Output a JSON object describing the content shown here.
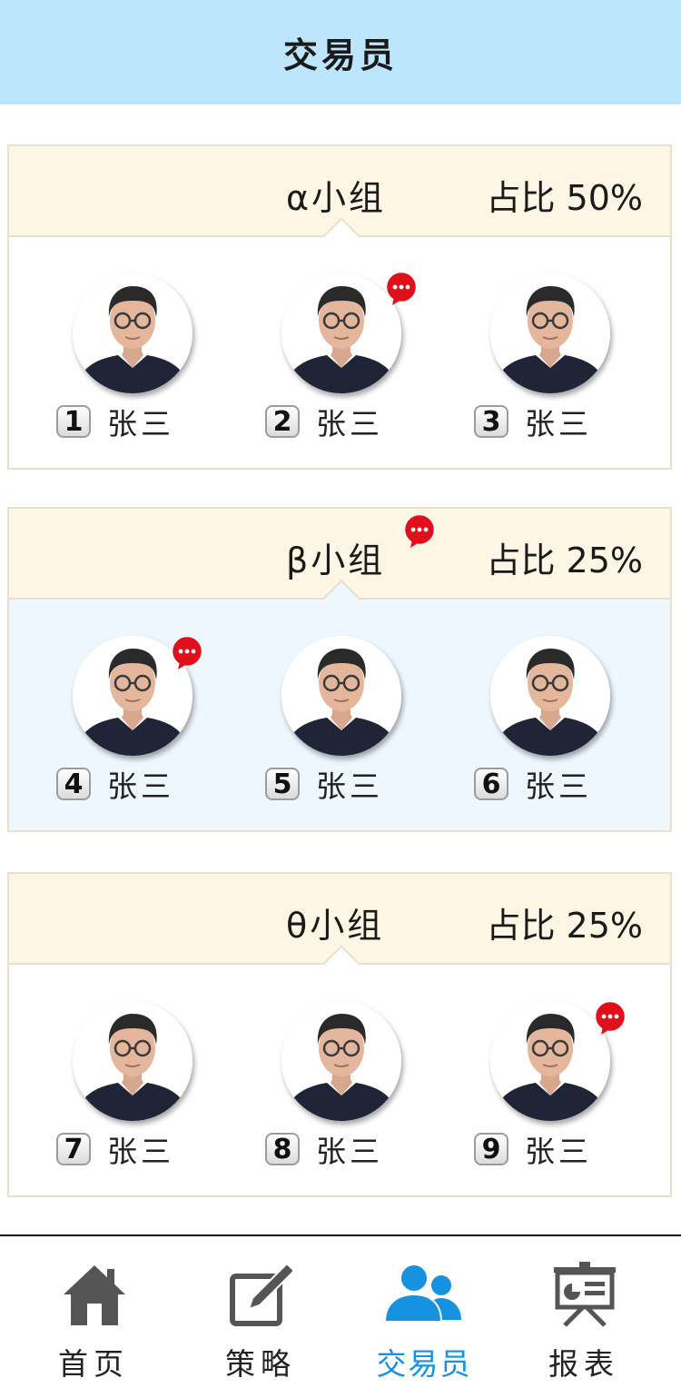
{
  "header": {
    "title": "交易员"
  },
  "groups": [
    {
      "name": "α小组",
      "share_label": "占比",
      "share_value": "50%",
      "members": [
        {
          "rank": "1",
          "name": "张三"
        },
        {
          "rank": "2",
          "name": "张三"
        },
        {
          "rank": "3",
          "name": "张三"
        }
      ]
    },
    {
      "name": "β小组",
      "share_label": "占比",
      "share_value": "25%",
      "members": [
        {
          "rank": "4",
          "name": "张三"
        },
        {
          "rank": "5",
          "name": "张三"
        },
        {
          "rank": "6",
          "name": "张三"
        }
      ]
    },
    {
      "name": "θ小组",
      "share_label": "占比",
      "share_value": "25%",
      "members": [
        {
          "rank": "7",
          "name": "张三"
        },
        {
          "rank": "8",
          "name": "张三"
        },
        {
          "rank": "9",
          "name": "张三"
        }
      ]
    }
  ],
  "tabbar": {
    "items": [
      {
        "label": "首页",
        "icon": "home-icon",
        "active": false
      },
      {
        "label": "策略",
        "icon": "edit-icon",
        "active": false
      },
      {
        "label": "交易员",
        "icon": "users-icon",
        "active": true
      },
      {
        "label": "报表",
        "icon": "presentation-icon",
        "active": false
      }
    ]
  },
  "colors": {
    "header_bg": "#bde5fc",
    "group_head_bg": "#fdf6e5",
    "highlight_bg": "#eef6fe",
    "accent": "#1692e0",
    "badge": "#e0101a"
  }
}
